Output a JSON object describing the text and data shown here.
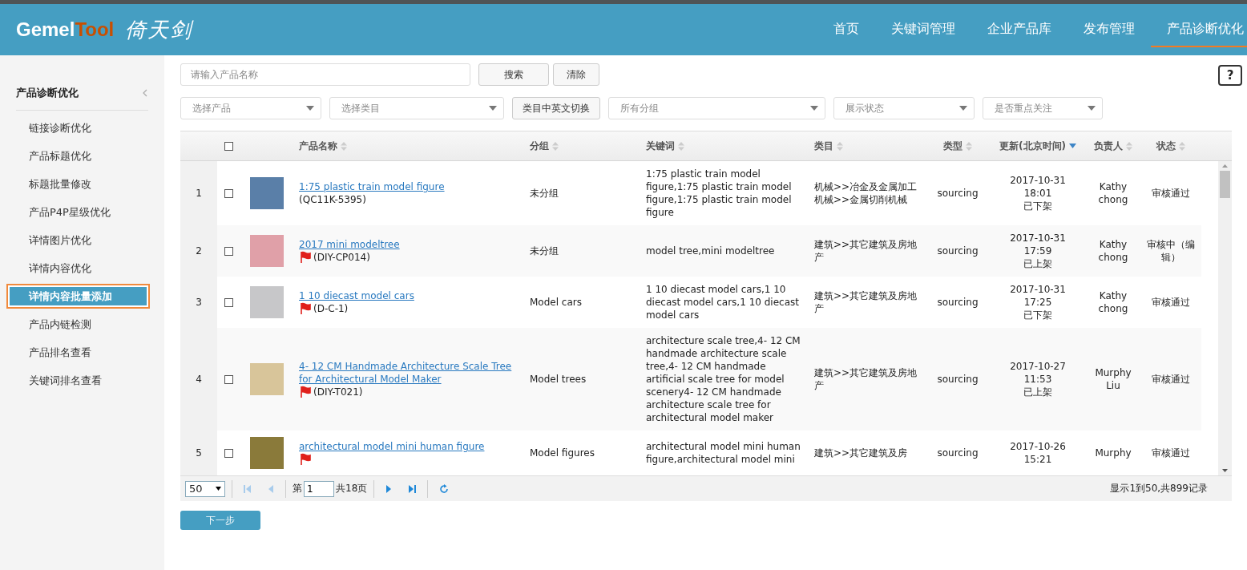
{
  "logo": {
    "text": "Gemel",
    "accent": "Tool",
    "tagline": "倚天剑"
  },
  "nav": [
    {
      "label": "首页",
      "selected": false
    },
    {
      "label": "关键词管理",
      "selected": false
    },
    {
      "label": "企业产品库",
      "selected": false
    },
    {
      "label": "发布管理",
      "selected": false
    },
    {
      "label": "产品诊断优化",
      "selected": true
    }
  ],
  "sidebar": {
    "title": "产品诊断优化",
    "items": [
      {
        "label": "链接诊断优化",
        "selected": false
      },
      {
        "label": "产品标题优化",
        "selected": false
      },
      {
        "label": "标题批量修改",
        "selected": false
      },
      {
        "label": "产品P4P星级优化",
        "selected": false
      },
      {
        "label": "详情图片优化",
        "selected": false
      },
      {
        "label": "详情内容优化",
        "selected": false
      },
      {
        "label": "详情内容批量添加",
        "selected": true
      },
      {
        "label": "产品内链检测",
        "selected": false
      },
      {
        "label": "产品排名查看",
        "selected": false
      },
      {
        "label": "关键词排名查看",
        "selected": false
      }
    ]
  },
  "search": {
    "placeholder": "请输入产品名称",
    "buttons": [
      "搜索",
      "清除"
    ]
  },
  "help": "?",
  "filters": [
    {
      "kind": "select",
      "placeholder": "选择产品"
    },
    {
      "kind": "select",
      "placeholder": "选择类目"
    },
    {
      "kind": "button",
      "label": "类目中英文切换"
    },
    {
      "kind": "select",
      "placeholder": "所有分组"
    },
    {
      "kind": "select",
      "placeholder": "展示状态"
    },
    {
      "kind": "select",
      "placeholder": "是否重点关注"
    }
  ],
  "table": {
    "header_checked": false,
    "columns": [
      {
        "label": "产品名称",
        "sorted": false
      },
      {
        "label": "分组",
        "sorted": false
      },
      {
        "label": "关键词",
        "sorted": false
      },
      {
        "label": "类目",
        "sorted": false
      },
      {
        "label": "类型",
        "sorted": false
      },
      {
        "label": "更新(北京时间)",
        "sorted": true
      },
      {
        "label": "负责人",
        "sorted": false
      },
      {
        "label": "状态",
        "sorted": false
      }
    ],
    "rows": [
      {
        "index": "1",
        "checked": false,
        "name": "1:75 plastic train model figure",
        "flagged": false,
        "code": "(QC11K-5395)",
        "group": "未分组",
        "keywords": "1:75 plastic train model figure,1:75 plastic train model figure,1:75 plastic train model figure",
        "category": "机械>>冶金及金属加工机械>>金属切削机械",
        "type": "sourcing",
        "date": "2017-10-31",
        "time": "18:01",
        "shelf": "已下架",
        "owner": "Kathy chong",
        "status": "审核通过"
      },
      {
        "index": "2",
        "checked": false,
        "name": "2017 mini modeltree",
        "flagged": true,
        "code": "(DIY-CP014)",
        "group": "未分组",
        "keywords": "model tree,mini modeltree",
        "category": "建筑>>其它建筑及房地产",
        "type": "sourcing",
        "date": "2017-10-31",
        "time": "17:59",
        "shelf": "已上架",
        "owner": "Kathy chong",
        "status": "审核中（编辑）"
      },
      {
        "index": "3",
        "checked": false,
        "name": "1 10 diecast model cars",
        "flagged": true,
        "code": "(D-C-1)",
        "group": "Model cars",
        "keywords": "1 10 diecast model cars,1 10 diecast model cars,1 10 diecast model cars",
        "category": "建筑>>其它建筑及房地产",
        "type": "sourcing",
        "date": "2017-10-31",
        "time": "17:25",
        "shelf": "已下架",
        "owner": "Kathy chong",
        "status": "审核通过"
      },
      {
        "index": "4",
        "checked": false,
        "name": "4- 12 CM Handmade Architecture Scale Tree for Architectural Model Maker",
        "flagged": true,
        "code": "(DIY-T021)",
        "group": "Model trees",
        "keywords": "architecture scale tree,4- 12 CM handmade architecture scale tree,4- 12 CM handmade artificial scale tree for model scenery4- 12 CM handmade architecture scale tree for architectural model maker",
        "category": "建筑>>其它建筑及房地产",
        "type": "sourcing",
        "date": "2017-10-27",
        "time": "11:53",
        "shelf": "已上架",
        "owner": "Murphy Liu",
        "status": "审核通过"
      },
      {
        "index": "5",
        "checked": false,
        "name": "architectural model mini human figure",
        "flagged": true,
        "group": "Model figures",
        "keywords": "architectural model mini human figure,architectural model mini",
        "category": "建筑>>其它建筑及房",
        "type": "sourcing",
        "date": "2017-10-26",
        "time": "15:21",
        "owner": "Murphy",
        "status": "审核通过"
      }
    ]
  },
  "pager": {
    "page_size": "50",
    "page_prefix": "第",
    "page": "1",
    "page_total": "共18页",
    "first_disabled": true,
    "last_disabled": false,
    "summary": "显示1到50,共899记录"
  },
  "next_button": "下一步"
}
